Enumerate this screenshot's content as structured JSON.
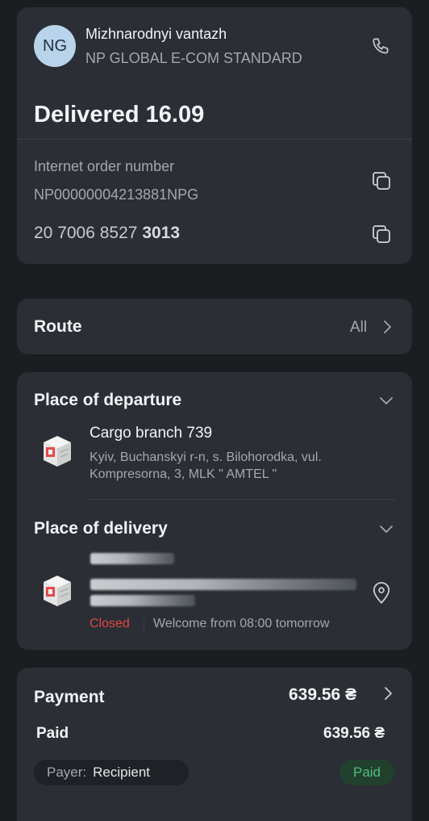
{
  "sender": {
    "initials": "NG",
    "name": "Mizhnarodnyi vantazh",
    "service": "NP GLOBAL E-COM STANDARD"
  },
  "status": {
    "title": "Delivered 16.09"
  },
  "order": {
    "label": "Internet order number",
    "number": "NP00000004213881NPG",
    "ttn_prefix": "20 7006 8527",
    "ttn_suffix": "3013"
  },
  "route": {
    "title": "Route",
    "link": "All"
  },
  "departure": {
    "title": "Place of departure",
    "branch": "Cargo branch 739",
    "address_line1": "Kyiv, Buchanskyi r-n, s. Bilohorodka, vul.",
    "address_line2": "Kompresorna, 3, MLK \" AMTEL \""
  },
  "delivery": {
    "title": "Place of delivery",
    "status": "Closed",
    "hours": "Welcome from 08:00 tomorrow"
  },
  "payment": {
    "title": "Payment",
    "total": "639.56 ₴",
    "paid_label": "Paid",
    "paid_amount": "639.56 ₴",
    "payer_label": "Payer:",
    "payer_value": "Recipient",
    "badge": "Paid"
  },
  "colors": {
    "background": "#1b1d21",
    "card": "#2b2e35",
    "closed": "#e0473f",
    "paid_badge_bg": "#22402e",
    "paid_badge_text": "#4fbf7a"
  },
  "icons": [
    "phone-icon",
    "copy-icon",
    "chevron-right-icon",
    "chevron-down-icon",
    "building-icon",
    "map-pin-icon"
  ]
}
